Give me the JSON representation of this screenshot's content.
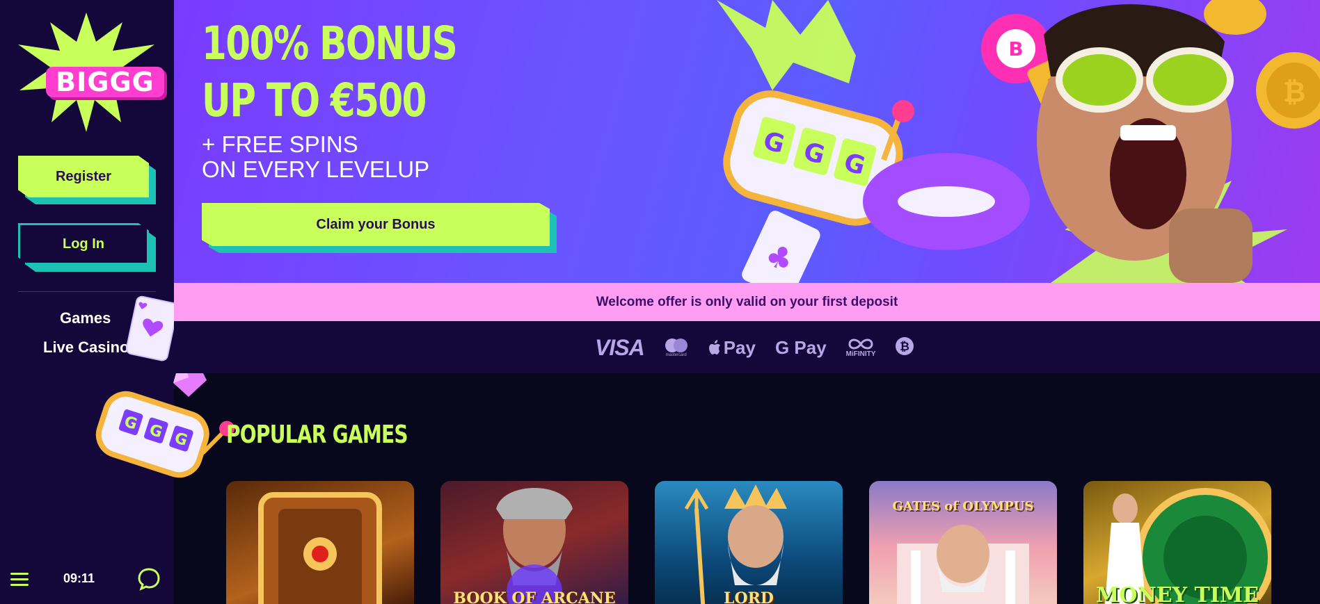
{
  "brand": {
    "logo_text": "BIGGG"
  },
  "sidebar": {
    "register_label": "Register",
    "login_label": "Log In",
    "nav": [
      {
        "label": "Games"
      },
      {
        "label": "Live Casino"
      }
    ],
    "time": "09:11"
  },
  "banner": {
    "title_line1": "100% BONUS",
    "title_line2": "UP TO €500",
    "sub_line1": "+ FREE SPINS",
    "sub_line2": "ON EVERY LEVELUP",
    "claim_label": "Claim your Bonus",
    "offer_note": "Welcome offer is only valid on your first deposit"
  },
  "payments": [
    {
      "name": "VISA",
      "icon": "visa-icon"
    },
    {
      "name": "mastercard",
      "icon": "mastercard-icon"
    },
    {
      "name": "Pay",
      "icon": "apple-pay-icon"
    },
    {
      "name": "G Pay",
      "icon": "google-pay-icon"
    },
    {
      "name": "MiFINITY",
      "icon": "mifinity-icon"
    },
    {
      "name": "Bitcoin",
      "icon": "bitcoin-icon"
    }
  ],
  "popular": {
    "title": "POPULAR GAMES",
    "games": [
      {
        "title": ""
      },
      {
        "title": "BOOK OF ARCANE"
      },
      {
        "title": "LORD"
      },
      {
        "title": "GATES of OLYMPUS"
      },
      {
        "title": "MONEY TIME"
      }
    ]
  },
  "colors": {
    "accent_lime": "#c9ff5b",
    "accent_teal": "#1ec2b4",
    "sidebar_bg": "#14073a",
    "page_bg": "#08081c",
    "strip_pink": "#ff9df3"
  }
}
